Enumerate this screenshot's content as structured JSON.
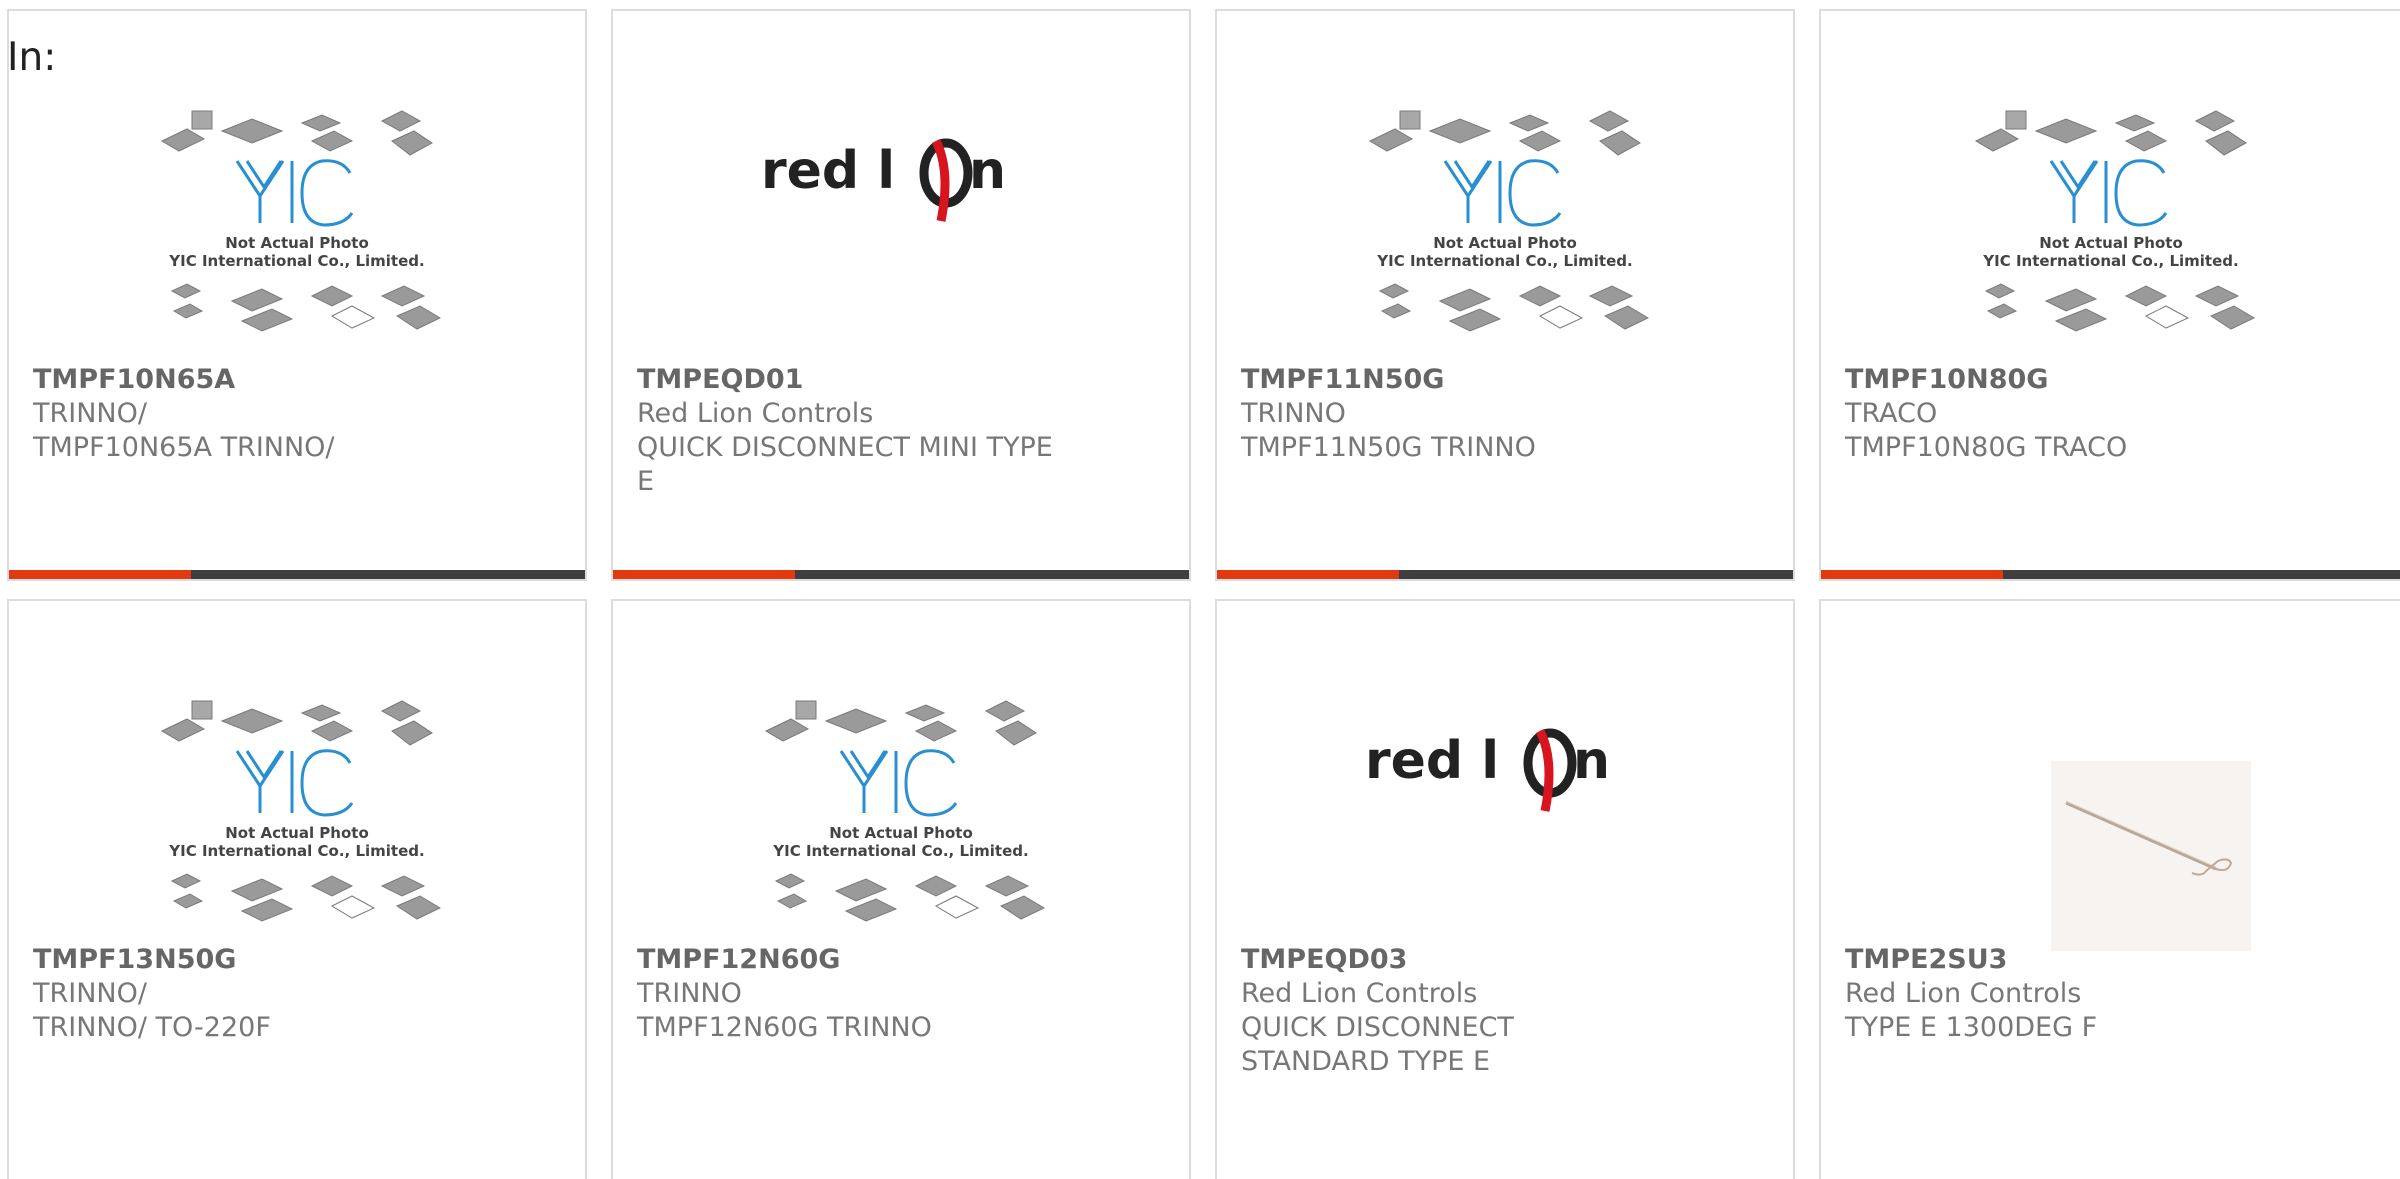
{
  "header": {
    "label": "In:"
  },
  "colors": {
    "accent": "#e23a10",
    "bar": "#3e3e3e",
    "yic_blue": "#2a8fd0",
    "redlion_red": "#d8141e"
  },
  "products": [
    {
      "part": "TMPF10N65A",
      "manufacturer": "TRINNO/",
      "description": "TMPF10N65A TRINNO/",
      "image": "yic-placeholder",
      "image_caption_1": "Not Actual Photo",
      "image_caption_2": "YIC International Co., Limited."
    },
    {
      "part": "TMPEQD01",
      "manufacturer": "Red Lion Controls",
      "description": "QUICK DISCONNECT MINI TYPE E",
      "image": "red-lion-logo",
      "logo_text": "red lion"
    },
    {
      "part": "TMPF11N50G",
      "manufacturer": "TRINNO",
      "description": "TMPF11N50G TRINNO",
      "image": "yic-placeholder",
      "image_caption_1": "Not Actual Photo",
      "image_caption_2": "YIC International Co., Limited."
    },
    {
      "part": "TMPF10N80G",
      "manufacturer": "TRACO",
      "description": "TMPF10N80G TRACO",
      "image": "yic-placeholder",
      "image_caption_1": "Not Actual Photo",
      "image_caption_2": "YIC International Co., Limited."
    },
    {
      "part": "TMPF13N50G",
      "manufacturer": "TRINNO/",
      "description": "TRINNO/ TO-220F",
      "image": "yic-placeholder",
      "image_caption_1": "Not Actual Photo",
      "image_caption_2": "YIC International Co., Limited."
    },
    {
      "part": "TMPF12N60G",
      "manufacturer": "TRINNO",
      "description": "TMPF12N60G TRINNO",
      "image": "yic-placeholder",
      "image_caption_1": "Not Actual Photo",
      "image_caption_2": "YIC International Co., Limited."
    },
    {
      "part": "TMPEQD03",
      "manufacturer": "Red Lion Controls",
      "description": "QUICK DISCONNECT STANDARD TYPE E",
      "image": "red-lion-logo",
      "logo_text": "red lion"
    },
    {
      "part": "TMPE2SU3",
      "manufacturer": "Red Lion Controls",
      "description": "TYPE E 1300DEG F",
      "image": "thermocouple-probe-photo"
    }
  ]
}
